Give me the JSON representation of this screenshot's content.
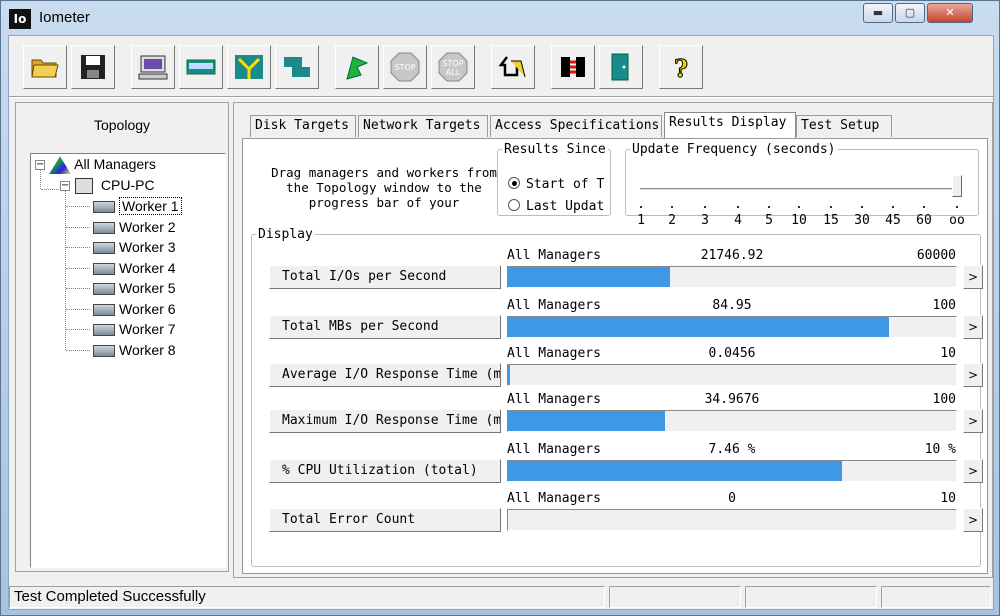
{
  "window": {
    "title": "Iometer",
    "icon_text": "Io"
  },
  "toolbar": {
    "buttons": [
      {
        "name": "open-button",
        "icon": "folder-open-icon"
      },
      {
        "name": "save-button",
        "icon": "floppy-disk-icon"
      },
      {
        "name": "start-new-manager-button",
        "icon": "computer-icon"
      },
      {
        "name": "start-disk-worker-button",
        "icon": "disk-worker-icon"
      },
      {
        "name": "start-network-worker-button",
        "icon": "network-worker-icon"
      },
      {
        "name": "duplicate-worker-button",
        "icon": "duplicate-icon"
      },
      {
        "name": "start-tests-button",
        "icon": "green-flag-icon"
      },
      {
        "name": "stop-button",
        "icon": "stop-sign-icon",
        "label": "STOP"
      },
      {
        "name": "stop-all-button",
        "icon": "stop-all-icon",
        "label": "STOP\nALL"
      },
      {
        "name": "reset-workers-button",
        "icon": "reset-arrow-icon"
      },
      {
        "name": "disconnect-button",
        "icon": "disconnect-icon"
      },
      {
        "name": "exit-button",
        "icon": "exit-door-icon"
      },
      {
        "name": "about-button",
        "icon": "question-mark-icon",
        "label": "?"
      }
    ]
  },
  "topology": {
    "title": "Topology",
    "root": "All Managers",
    "manager": "CPU-PC",
    "workers": [
      "Worker 1",
      "Worker 2",
      "Worker 3",
      "Worker 4",
      "Worker 5",
      "Worker 6",
      "Worker 7",
      "Worker 8"
    ]
  },
  "tabs": [
    {
      "label": "Disk Targets",
      "active": false
    },
    {
      "label": "Network Targets",
      "active": false
    },
    {
      "label": "Access Specifications",
      "active": false
    },
    {
      "label": "Results Display",
      "active": true
    },
    {
      "label": "Test Setup",
      "active": false
    }
  ],
  "results_display": {
    "drag_hint": "Drag managers and workers from the Topology window to the progress bar of your",
    "results_since": {
      "legend": "Results Since",
      "options": [
        {
          "label": "Start of T",
          "selected": true
        },
        {
          "label": "Last Updat",
          "selected": false
        }
      ]
    },
    "update_frequency": {
      "legend": "Update Frequency (seconds)",
      "ticks": [
        "1",
        "2",
        "3",
        "4",
        "5",
        "10",
        "15",
        "30",
        "45",
        "60",
        "oo"
      ],
      "selected": "oo"
    },
    "display": {
      "legend": "Display",
      "metrics": [
        {
          "label": "Total I/Os per Second",
          "target": "All Managers",
          "value": "21746.92",
          "max": "60000",
          "fill": 0.3625
        },
        {
          "label": "Total MBs per Second",
          "target": "All Managers",
          "value": "84.95",
          "max": "100",
          "fill": 0.8495
        },
        {
          "label": "Average I/O Response Time (m",
          "target": "All Managers",
          "value": "0.0456",
          "max": "10",
          "fill": 0.0046
        },
        {
          "label": "Maximum I/O Response Time (m",
          "target": "All Managers",
          "value": "34.9676",
          "max": "100",
          "fill": 0.3497
        },
        {
          "label": "% CPU Utilization (total)",
          "target": "All Managers",
          "value": "7.46 %",
          "max": "10 %",
          "fill": 0.746
        },
        {
          "label": "Total Error Count",
          "target": "All Managers",
          "value": "0",
          "max": "10",
          "fill": 0
        }
      ],
      "arrow_label": ">"
    }
  },
  "status": {
    "message": "Test Completed Successfully"
  },
  "colors": {
    "bar": "#3d98e8",
    "title_bg": "#b9cfe6"
  }
}
